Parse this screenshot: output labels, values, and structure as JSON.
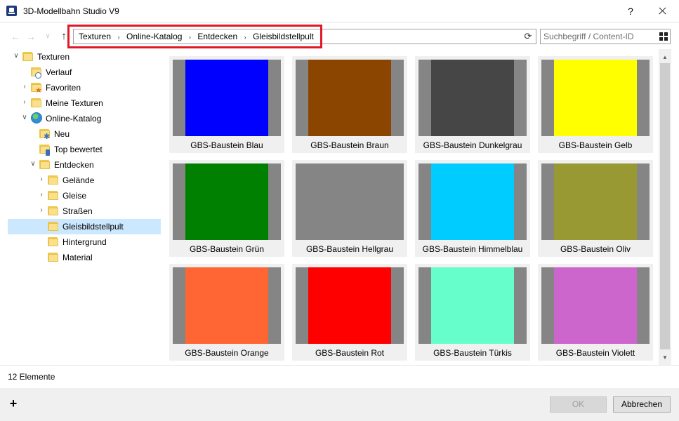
{
  "window": {
    "title": "3D-Modellbahn Studio V9",
    "help_label": "?"
  },
  "nav": {
    "back_glyph": "←",
    "forward_glyph": "→",
    "recent_glyph": "∨",
    "up_glyph": "↑",
    "breadcrumbs": [
      "Texturen",
      "Online-Katalog",
      "Entdecken",
      "Gleisbildstellpult"
    ],
    "separator": "›",
    "refresh_glyph": "⟳"
  },
  "search": {
    "placeholder": "Suchbegriff / Content-ID",
    "view_icon": "grid-view-icon"
  },
  "tree": [
    {
      "label": "Texturen",
      "level": 0,
      "expander": "expanded",
      "icon": "folder-icon"
    },
    {
      "label": "Verlauf",
      "level": 1,
      "expander": "none",
      "icon": "history-folder-icon"
    },
    {
      "label": "Favoriten",
      "level": 1,
      "expander": "collapsed",
      "icon": "favorites-folder-icon"
    },
    {
      "label": "Meine Texturen",
      "level": 1,
      "expander": "collapsed",
      "icon": "folder-icon"
    },
    {
      "label": "Online-Katalog",
      "level": 1,
      "expander": "expanded",
      "icon": "globe-icon"
    },
    {
      "label": "Neu",
      "level": 2,
      "expander": "none",
      "icon": "new-folder-icon"
    },
    {
      "label": "Top bewertet",
      "level": 2,
      "expander": "none",
      "icon": "top-rated-folder-icon"
    },
    {
      "label": "Entdecken",
      "level": 2,
      "expander": "expanded",
      "icon": "folder-icon"
    },
    {
      "label": "Gelände",
      "level": 3,
      "expander": "collapsed",
      "icon": "folder-icon"
    },
    {
      "label": "Gleise",
      "level": 3,
      "expander": "collapsed",
      "icon": "folder-icon"
    },
    {
      "label": "Straßen",
      "level": 3,
      "expander": "collapsed",
      "icon": "folder-icon"
    },
    {
      "label": "Gleisbildstellpult",
      "level": 3,
      "expander": "none",
      "icon": "folder-icon",
      "selected": true
    },
    {
      "label": "Hintergrund",
      "level": 3,
      "expander": "none",
      "icon": "folder-icon"
    },
    {
      "label": "Material",
      "level": 3,
      "expander": "none",
      "icon": "folder-icon"
    }
  ],
  "items": [
    {
      "label": "GBS-Baustein Blau",
      "color": "#0000ff",
      "side": "#858585"
    },
    {
      "label": "GBS-Baustein Braun",
      "color": "#8b4500",
      "side": "#858585"
    },
    {
      "label": "GBS-Baustein Dunkelgrau",
      "color": "#464646",
      "side": "#858585"
    },
    {
      "label": "GBS-Baustein Gelb",
      "color": "#ffff00",
      "side": "#858585"
    },
    {
      "label": "GBS-Baustein Grün",
      "color": "#008000",
      "side": "#858585"
    },
    {
      "label": "GBS-Baustein Hellgrau",
      "color": "#858585",
      "side": "#858585"
    },
    {
      "label": "GBS-Baustein Himmelblau",
      "color": "#00ccff",
      "side": "#858585"
    },
    {
      "label": "GBS-Baustein Oliv",
      "color": "#999933",
      "side": "#858585"
    },
    {
      "label": "GBS-Baustein Orange",
      "color": "#ff6633",
      "side": "#858585"
    },
    {
      "label": "GBS-Baustein Rot",
      "color": "#ff0000",
      "side": "#858585"
    },
    {
      "label": "GBS-Baustein Türkis",
      "color": "#66ffcc",
      "side": "#858585"
    },
    {
      "label": "GBS-Baustein Violett",
      "color": "#cc66cc",
      "side": "#858585"
    }
  ],
  "status": {
    "count_text": "12 Elemente"
  },
  "footer": {
    "add_label": "+",
    "ok_label": "OK",
    "cancel_label": "Abbrechen"
  },
  "colors": {
    "selection": "#cce8ff",
    "highlight": "#e0192a",
    "tile_bg": "#f0f0f0"
  }
}
